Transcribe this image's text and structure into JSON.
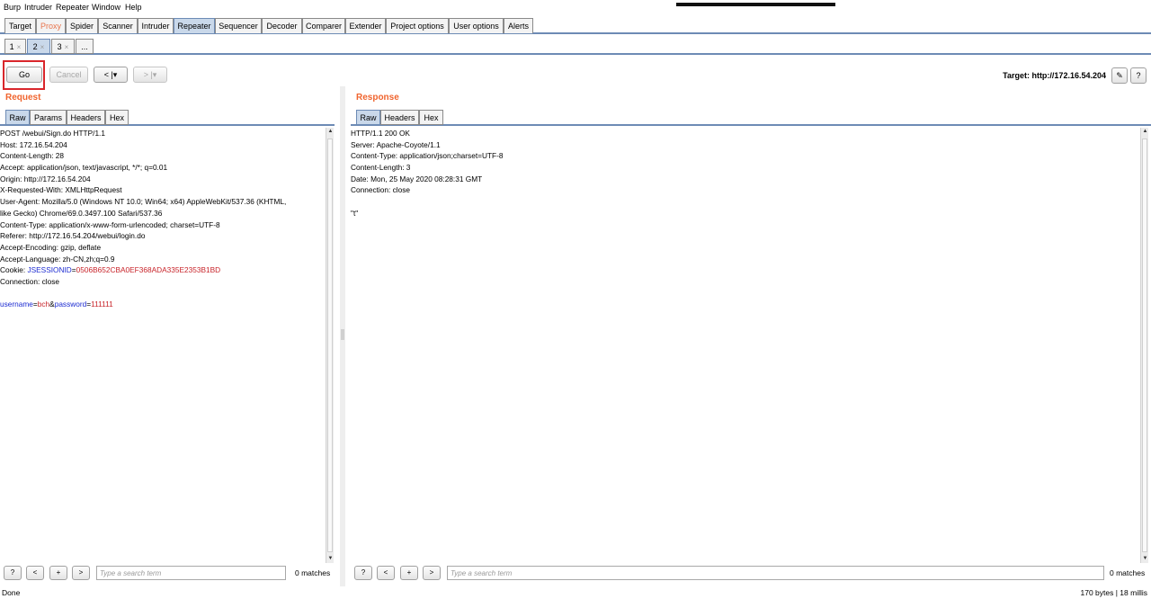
{
  "menu": [
    "Burp",
    "Intruder",
    "Repeater",
    "Window",
    "Help"
  ],
  "main_tabs": [
    {
      "label": "Target"
    },
    {
      "label": "Proxy"
    },
    {
      "label": "Spider"
    },
    {
      "label": "Scanner"
    },
    {
      "label": "Intruder"
    },
    {
      "label": "Repeater"
    },
    {
      "label": "Sequencer"
    },
    {
      "label": "Decoder"
    },
    {
      "label": "Comparer"
    },
    {
      "label": "Extender"
    },
    {
      "label": "Project options"
    },
    {
      "label": "User options"
    },
    {
      "label": "Alerts"
    }
  ],
  "repeater_tabs": [
    {
      "label": "1",
      "close": "×"
    },
    {
      "label": "2",
      "close": "×"
    },
    {
      "label": "3",
      "close": "×"
    },
    {
      "label": "..."
    }
  ],
  "toolbar": {
    "go_label": "Go",
    "cancel_label": "Cancel",
    "back_label": "< |▾",
    "forward_label": "> |▾",
    "target_label": "Target: http://172.16.54.204",
    "edit_icon": "✎",
    "help_label": "?"
  },
  "request": {
    "title": "Request",
    "tabs": [
      "Raw",
      "Params",
      "Headers",
      "Hex"
    ],
    "lines": [
      "POST /webui/Sign.do HTTP/1.1",
      "Host: 172.16.54.204",
      "Content-Length: 28",
      "Accept: application/json, text/javascript, */*; q=0.01",
      "Origin: http://172.16.54.204",
      "X-Requested-With: XMLHttpRequest",
      "User-Agent: Mozilla/5.0 (Windows NT 10.0; Win64; x64) AppleWebKit/537.36 (KHTML,",
      "like Gecko) Chrome/69.0.3497.100 Safari/537.36",
      "Content-Type: application/x-www-form-urlencoded; charset=UTF-8",
      "Referer: http://172.16.54.204/webui/login.do",
      "Accept-Encoding: gzip, deflate",
      "Accept-Language: zh-CN,zh;q=0.9"
    ],
    "cookie": {
      "prefix": "Cookie: ",
      "name": "JSESSIONID",
      "eq": "=",
      "value": "0506B652CBA0EF368ADA335E2353B1BD"
    },
    "connection": "Connection: close",
    "body": {
      "k1": "username",
      "eq1": "=",
      "v1": "bch",
      "amp": "&",
      "k2": "password",
      "eq2": "=",
      "v2": "111111"
    },
    "search": {
      "help": "?",
      "prev": "<",
      "add": "+",
      "next": ">",
      "placeholder": "Type a search term",
      "matches": "0 matches"
    }
  },
  "response": {
    "title": "Response",
    "tabs": [
      "Raw",
      "Headers",
      "Hex"
    ],
    "lines": [
      "HTTP/1.1 200 OK",
      "Server: Apache-Coyote/1.1",
      "Content-Type: application/json;charset=UTF-8",
      "Content-Length: 3",
      "Date: Mon, 25 May 2020 08:28:31 GMT",
      "Connection: close",
      "",
      "\"t\""
    ],
    "search": {
      "help": "?",
      "prev": "<",
      "add": "+",
      "next": ">",
      "placeholder": "Type a search term",
      "matches": "0 matches"
    }
  },
  "status": {
    "left": "Done",
    "right": "170 bytes | 18 millis"
  },
  "colors": {
    "accent_orange": "#f0642e",
    "tab_active": "#c9d8ea",
    "highlight_red": "#d9262b",
    "param_name_blue": "#1c2bd1",
    "param_value_red": "#c8242a"
  }
}
